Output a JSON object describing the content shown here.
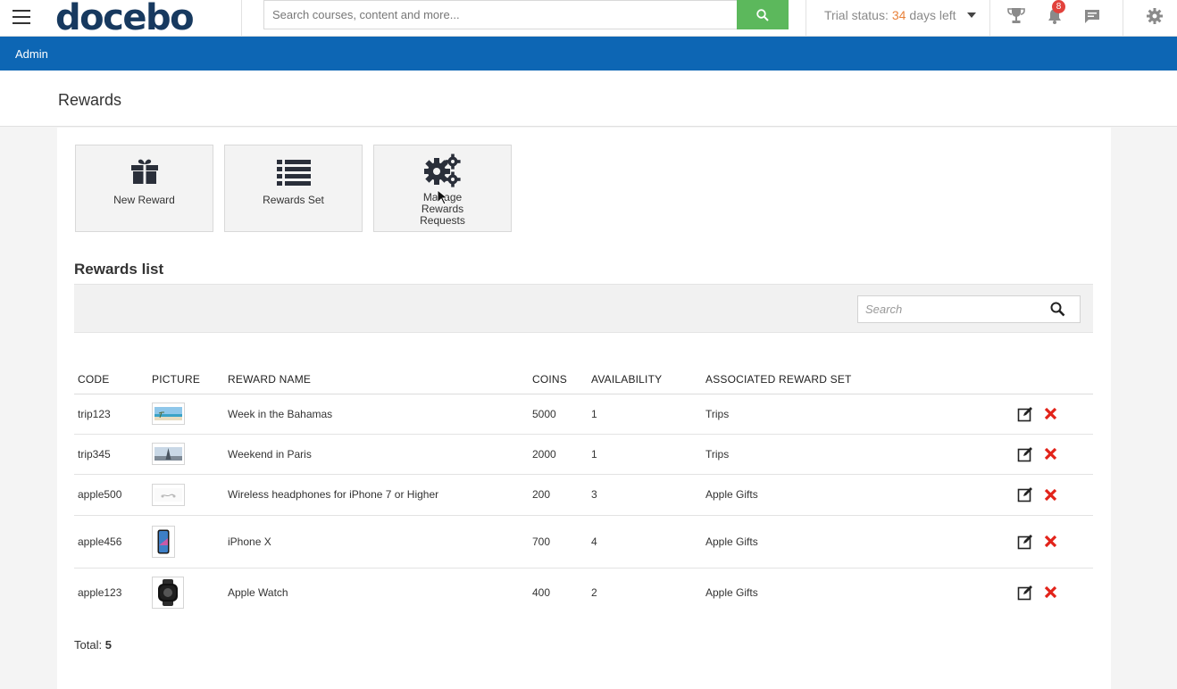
{
  "topbar": {
    "logo_text": "docebo",
    "logo_mark": "®",
    "search_placeholder": "Search courses, content and more...",
    "trial_label": "Trial status:",
    "trial_days": "34",
    "trial_suffix": "days left",
    "notification_count": "8",
    "icons": [
      "hamburger-menu-icon",
      "search-icon",
      "trophy-icon",
      "bell-icon",
      "chat-icon",
      "gear-icon"
    ]
  },
  "adminbar": {
    "label": "Admin"
  },
  "page": {
    "title": "Rewards"
  },
  "actions": [
    {
      "label": "New Reward",
      "icon": "gift-icon"
    },
    {
      "label": "Rewards Set",
      "icon": "list-icon"
    },
    {
      "label": "Manage Rewards Requests",
      "icon": "gears-icon"
    }
  ],
  "rewards_list": {
    "title": "Rewards list",
    "search_placeholder": "Search",
    "columns": [
      "CODE",
      "PICTURE",
      "REWARD NAME",
      "COINS",
      "AVAILABILITY",
      "ASSOCIATED REWARD SET"
    ],
    "rows": [
      {
        "code": "trip123",
        "name": "Week in the Bahamas",
        "coins": "5000",
        "availability": "1",
        "set": "Trips"
      },
      {
        "code": "trip345",
        "name": "Weekend in Paris",
        "coins": "2000",
        "availability": "1",
        "set": "Trips"
      },
      {
        "code": "apple500",
        "name": "Wireless headphones for iPhone 7 or Higher",
        "coins": "200",
        "availability": "3",
        "set": "Apple Gifts"
      },
      {
        "code": "apple456",
        "name": "iPhone X",
        "coins": "700",
        "availability": "4",
        "set": "Apple Gifts"
      },
      {
        "code": "apple123",
        "name": "Apple Watch",
        "coins": "400",
        "availability": "2",
        "set": "Apple Gifts"
      }
    ],
    "total_label": "Total:",
    "total_value": "5"
  },
  "colors": {
    "brand_blue": "#0d66b4",
    "logo_navy": "#17395f",
    "search_green": "#5cb85c",
    "trial_orange": "#e8813a",
    "delete_red": "#e2231a"
  }
}
